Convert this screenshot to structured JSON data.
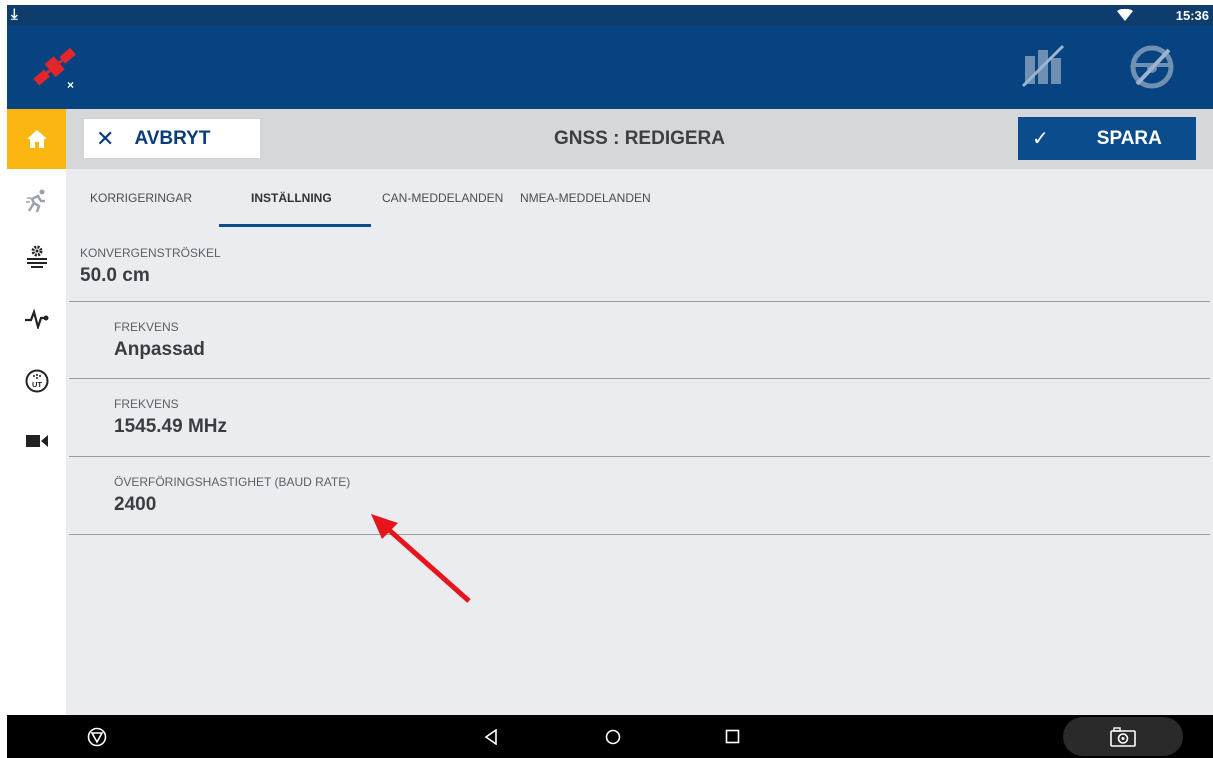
{
  "status_bar": {
    "time": "15:36",
    "download_icon": "download-icon",
    "wifi_icon": "wifi-icon"
  },
  "app_bar": {
    "left_icon": "gnss-satellite-disconnected-icon",
    "right_icons": [
      "field-map-icon",
      "steering-disabled-icon"
    ]
  },
  "sidebar": {
    "items": [
      {
        "name": "home",
        "icon": "home-icon",
        "active": true
      },
      {
        "name": "run",
        "icon": "running-icon"
      },
      {
        "name": "implement-settings",
        "icon": "gear-layers-icon"
      },
      {
        "name": "diagnostics",
        "icon": "pulse-icon"
      },
      {
        "name": "ut",
        "icon": "universal-terminal-icon",
        "label": "UT"
      },
      {
        "name": "camera",
        "icon": "video-camera-icon"
      }
    ]
  },
  "header": {
    "cancel_label": "AVBRYT",
    "title": "GNSS : REDIGERA",
    "save_label": "SPARA"
  },
  "tabs": [
    {
      "label": "KORRIGERINGAR",
      "active": false
    },
    {
      "label": "INSTÄLLNING",
      "active": true
    },
    {
      "label": "CAN-MEDDELANDEN",
      "active": false
    },
    {
      "label": "NMEA-MEDDELANDEN",
      "active": false
    }
  ],
  "fields": [
    {
      "label": "KONVERGENSTRÖSKEL",
      "value": "50.0 cm"
    },
    {
      "label": "FREKVENS",
      "value": "Anpassad"
    },
    {
      "label": "FREKVENS",
      "value": "1545.49 MHz"
    },
    {
      "label": "ÖVERFÖRINGSHASTIGHET (BAUD RATE)",
      "value": "2400"
    }
  ],
  "annotation": {
    "arrow_color": "#e8141c"
  },
  "nav_bar": {
    "icons": [
      "stop-icon",
      "back-icon",
      "home-circle-icon",
      "recents-icon",
      "screenshot-camera-icon"
    ]
  },
  "colors": {
    "app_bar": "#064380",
    "accent_yellow": "#fbb612",
    "primary_blue": "#0a4c8c"
  }
}
